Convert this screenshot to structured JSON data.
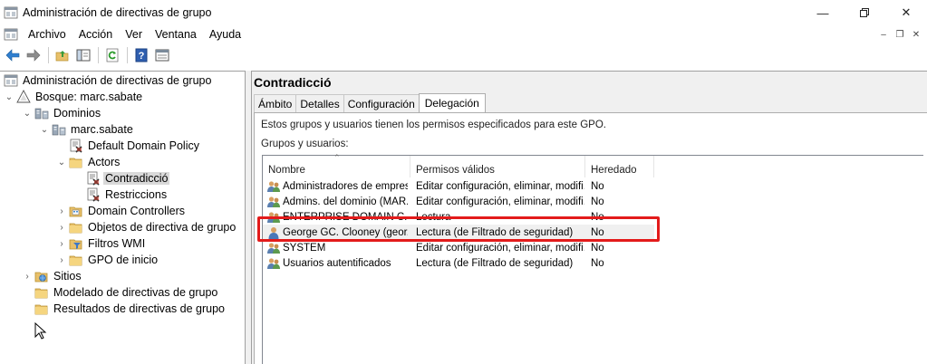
{
  "window": {
    "title": "Administración de directivas de grupo",
    "minimize_icon": "minimize-icon",
    "maximize_icon": "restore-icon",
    "close_icon": "close-icon"
  },
  "menu": [
    "Archivo",
    "Acción",
    "Ver",
    "Ventana",
    "Ayuda"
  ],
  "toolbar": [
    "back-arrow-icon",
    "forward-arrow-icon",
    "folder-up-icon",
    "show-tree-icon",
    "refresh-icon",
    "help-icon",
    "properties-icon"
  ],
  "tree": {
    "root": "Administración de directivas de grupo",
    "forest": "Bosque: marc.sabate",
    "domains": "Dominios",
    "domain": "marc.sabate",
    "default_policy": "Default Domain Policy",
    "actors": "Actors",
    "contradiccio": "Contradicció",
    "restriccions": "Restriccions",
    "domain_controllers": "Domain Controllers",
    "gpo_objects": "Objetos de directiva de grupo",
    "wmi_filters": "Filtros WMI",
    "starter_gpos": "GPO de inicio",
    "sites": "Sitios",
    "modeling": "Modelado de directivas de grupo",
    "results": "Resultados de directivas de grupo"
  },
  "gpo": {
    "title": "Contradicció",
    "tabs": [
      "Ámbito",
      "Detalles",
      "Configuración",
      "Delegación"
    ],
    "active_tab": "Delegación",
    "description": "Estos grupos y usuarios tienen los permisos especificados para este GPO.",
    "groups_label": "Grupos y usuarios:",
    "columns": [
      "Nombre",
      "Permisos válidos",
      "Heredado"
    ],
    "rows": [
      {
        "name": "Administradores de empres...",
        "perm": "Editar configuración, eliminar, modifi...",
        "inherited": "No",
        "icon": "group-icon"
      },
      {
        "name": "Admins. del dominio (MAR...",
        "perm": "Editar configuración, eliminar, modifi...",
        "inherited": "No",
        "icon": "group-icon"
      },
      {
        "name": "ENTERPRISE DOMAIN C...",
        "perm": "Lectura",
        "inherited": "No",
        "icon": "group-icon"
      },
      {
        "name": "George GC. Clooney (geor...",
        "perm": "Lectura (de Filtrado de seguridad)",
        "inherited": "No",
        "icon": "user-icon"
      },
      {
        "name": "SYSTEM",
        "perm": "Editar configuración, eliminar, modifi...",
        "inherited": "No",
        "icon": "group-icon"
      },
      {
        "name": "Usuarios autentificados",
        "perm": "Lectura (de Filtrado de seguridad)",
        "inherited": "No",
        "icon": "group-icon"
      }
    ],
    "highlight_color": "#e31b1b"
  }
}
